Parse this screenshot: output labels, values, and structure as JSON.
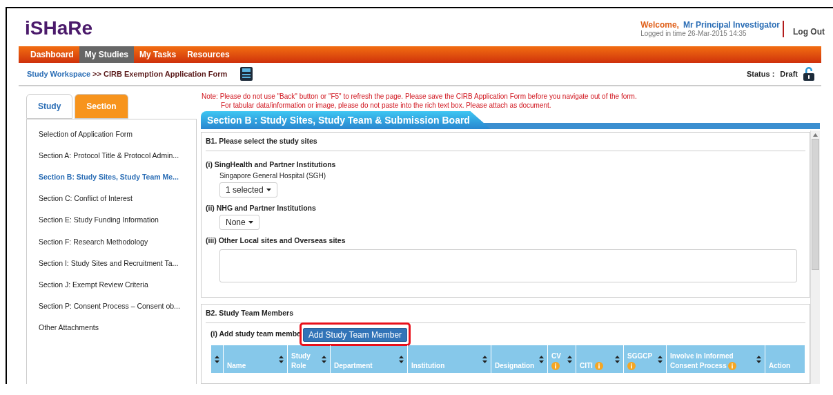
{
  "header": {
    "logo": "iSHaRe",
    "welcome": "Welcome,",
    "user": "Mr Principal Investigator",
    "login_time": "Logged in time 26-Mar-2015 14:35",
    "logout": "Log Out"
  },
  "nav": [
    {
      "label": "Dashboard",
      "selected": false
    },
    {
      "label": "My Studies",
      "selected": true
    },
    {
      "label": "My Tasks",
      "selected": false
    },
    {
      "label": "Resources",
      "selected": false
    }
  ],
  "breadcrumb": {
    "link": "Study Workspace",
    "current": ">> CIRB Exemption Application Form"
  },
  "status": {
    "label": "Status :",
    "value": "Draft"
  },
  "notes": [
    "Note: Please do not use \"Back\" button or \"F5\" to refresh the page. Please save the CIRB Application Form before you navigate out of the form.",
    "For tabular data/information or image, please do not paste into the rich text box. Please attach as document."
  ],
  "side_tabs": [
    {
      "label": "Study",
      "selected": false
    },
    {
      "label": "Section",
      "selected": true
    }
  ],
  "sidebar": [
    {
      "label": "Selection of Application Form",
      "selected": false
    },
    {
      "label": "Section A: Protocol Title & Protocol Admin...",
      "selected": false
    },
    {
      "label": "Section B: Study Sites, Study Team Me...",
      "selected": true
    },
    {
      "label": "Section C: Conflict of Interest",
      "selected": false
    },
    {
      "label": "Section E: Study Funding Information",
      "selected": false
    },
    {
      "label": "Section F: Research Methodology",
      "selected": false
    },
    {
      "label": "Section I: Study Sites and Recruitment Ta...",
      "selected": false
    },
    {
      "label": "Section J: Exempt Review Criteria",
      "selected": false
    },
    {
      "label": "Section P: Consent Process – Consent ob...",
      "selected": false
    },
    {
      "label": "Other Attachments",
      "selected": false
    }
  ],
  "section_title": "Section B : Study Sites, Study Team & Submission Board",
  "b1": {
    "title": "B1. Please select the study sites",
    "groups": [
      {
        "kind": "dropdown",
        "label": "(i) SingHealth and Partner Institutions",
        "sublabel": "Singapore General Hospital (SGH)",
        "value": "1 selected"
      },
      {
        "kind": "dropdown",
        "label": "(ii) NHG and Partner Institutions",
        "value": "None"
      },
      {
        "kind": "textarea",
        "label": "(iii) Other Local sites and Overseas sites"
      }
    ]
  },
  "b2": {
    "title": "B2. Study Team Members",
    "add_label": "(i) Add study team membe",
    "add_button": "Add Study Team Member",
    "columns": [
      {
        "sortable": true
      },
      {
        "label": "Name",
        "sortable": true,
        "info": false
      },
      {
        "label": "Study Role",
        "sortable": true,
        "info": false
      },
      {
        "label": "Department",
        "sortable": true,
        "info": false
      },
      {
        "label": "Institution",
        "sortable": true,
        "info": false
      },
      {
        "label": "Designation",
        "sortable": true,
        "info": false
      },
      {
        "label": "CV",
        "sortable": true,
        "info": true
      },
      {
        "label": "CITI",
        "sortable": true,
        "info": true
      },
      {
        "label": "SGGCP",
        "sortable": true,
        "info": true
      },
      {
        "label": "Involve in Informed Consent Process",
        "sortable": true,
        "info": true
      },
      {
        "label": "Action",
        "sortable": false,
        "info": false
      }
    ]
  }
}
